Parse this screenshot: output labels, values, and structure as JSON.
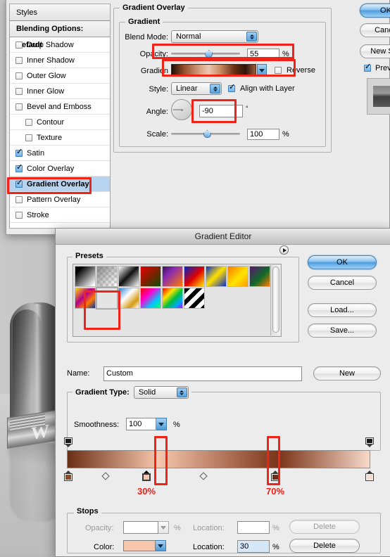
{
  "background": {
    "art_letter": "W",
    "art_letter_reflection": "W"
  },
  "layer_style_dialog": {
    "styles_panel": {
      "header": "Styles",
      "blending_options": "Blending Options: Default",
      "items": [
        {
          "label": "Drop Shadow",
          "checked": false,
          "indent": false,
          "selected": false
        },
        {
          "label": "Inner Shadow",
          "checked": false,
          "indent": false,
          "selected": false
        },
        {
          "label": "Outer Glow",
          "checked": false,
          "indent": false,
          "selected": false
        },
        {
          "label": "Inner Glow",
          "checked": false,
          "indent": false,
          "selected": false
        },
        {
          "label": "Bevel and Emboss",
          "checked": false,
          "indent": false,
          "selected": false
        },
        {
          "label": "Contour",
          "checked": false,
          "indent": true,
          "selected": false
        },
        {
          "label": "Texture",
          "checked": false,
          "indent": true,
          "selected": false
        },
        {
          "label": "Satin",
          "checked": true,
          "indent": false,
          "selected": false
        },
        {
          "label": "Color Overlay",
          "checked": true,
          "indent": false,
          "selected": false
        },
        {
          "label": "Gradient Overlay",
          "checked": true,
          "indent": false,
          "selected": true
        },
        {
          "label": "Pattern Overlay",
          "checked": false,
          "indent": false,
          "selected": false
        },
        {
          "label": "Stroke",
          "checked": false,
          "indent": false,
          "selected": false
        }
      ]
    },
    "gradient_overlay": {
      "section_title": "Gradient Overlay",
      "group_title": "Gradient",
      "blend_mode_label": "Blend Mode:",
      "blend_mode_value": "Normal",
      "opacity_label": "Opacity:",
      "opacity_value": "55",
      "opacity_unit": "%",
      "opacity_pct": 55,
      "gradient_label": "Gradien",
      "reverse_label": "Reverse",
      "reverse_checked": false,
      "style_label": "Style:",
      "style_value": "Linear",
      "align_label": "Align with Layer",
      "align_checked": true,
      "angle_label": "Angle:",
      "angle_value": "-90",
      "angle_unit": "°",
      "scale_label": "Scale:",
      "scale_value": "100",
      "scale_unit": "%",
      "scale_pct": 100
    },
    "buttons": {
      "ok": "OK",
      "cancel": "Cance",
      "new_style": "New Styl",
      "preview_label": "Previ",
      "preview_checked": true
    }
  },
  "gradient_editor": {
    "title": "Gradient Editor",
    "presets_title": "Presets",
    "presets_menu_icon": "triangle-right-icon",
    "name_label": "Name:",
    "name_value": "Custom",
    "new_button": "New",
    "gradient_type_label": "Gradient Type:",
    "gradient_type_value": "Solid",
    "smoothness_label": "Smoothness:",
    "smoothness_value": "100",
    "smoothness_unit": "%",
    "buttons": {
      "ok": "OK",
      "cancel": "Cancel",
      "load": "Load...",
      "save": "Save..."
    },
    "stops_panel": {
      "title": "Stops",
      "opacity_label": "Opacity:",
      "opacity_value": "",
      "opacity_unit": "%",
      "opacity_location_label": "Location:",
      "opacity_location_value": "",
      "opacity_location_unit": "%",
      "opacity_delete": "Delete",
      "opacity_delete_enabled": false,
      "color_label": "Color:",
      "color_value_hex": "#f6c7ad",
      "color_location_label": "Location:",
      "color_location_value": "30",
      "color_location_unit": "%",
      "color_delete": "Delete",
      "color_delete_enabled": true
    },
    "annotations": [
      {
        "label": "30%",
        "color": "#e8221a"
      },
      {
        "label": "70%",
        "color": "#e8221a"
      }
    ],
    "ramp": {
      "color_stops": [
        {
          "location": 0,
          "color": "#6b2f15"
        },
        {
          "location": 30,
          "color": "#f6c7ad",
          "active": true
        },
        {
          "location": 70,
          "color": "#7a3318"
        },
        {
          "location": 100,
          "color": "#f7dac9"
        }
      ],
      "opacity_stops": [
        {
          "location": 0,
          "opacity": 100
        },
        {
          "location": 100,
          "opacity": 100
        }
      ],
      "midpoints": [
        15,
        50
      ]
    },
    "preset_swatches": [
      "linear-gradient(135deg,#000 0%,#000 18%,#ffffff 95%)",
      "linear-gradient(135deg,rgba(120,120,120,.85),rgba(255,255,255,.1)),repeating-conic-gradient(#cfcfcf 0% 25%,#ffffff 0% 50%) 0 0/8px 8px",
      "linear-gradient(135deg,#ffffff 0%,#111111 48%,#ffffff 100%)",
      "linear-gradient(135deg,#e60000 0%,#8a1d00 45%,#0a4d00 100%)",
      "linear-gradient(135deg,#3b1060 0%,#8a2bb0 35%,#ff7a00 100%)",
      "linear-gradient(135deg,#0023c4 0%,#e00000 52%,#ffe400 100%)",
      "linear-gradient(135deg,#0b2ecc 0%,#ffe100 48%,#0b2ecc 100%)",
      "linear-gradient(135deg,#ff7a00 0%,#ffe400 55%,#ff9d00 100%)",
      "linear-gradient(135deg,#5d1470 0%,#0e6a2a 55%,#ff7a00 100%)",
      "linear-gradient(135deg,#ffd400 0%,#b4008c 42%,#ff7a00 70%,#0030a8 100%)",
      "linear-gradient(135deg,#e9dccf 0%,#8a4a2a 35%,#b9apple 0%,#dfc0a6 65%,#4a2512 100%)",
      "linear-gradient(135deg,#2f7fd0 0%,#ffffff 40%,#d89a10 75%,#ffffff 100%)",
      "linear-gradient(135deg,#ff0000 0%,#ff00d0 35%,#00c8ff 70%,#00ff66 100%)",
      "linear-gradient(135deg,#ff0000 0%,#ffe400 30%,#00c040 55%,#00a8ff 80%,#c000ff 100%)",
      "repeating-linear-gradient(135deg,#000 0 6px,#fff 6px 12px)"
    ],
    "selected_preset_index": 10
  }
}
